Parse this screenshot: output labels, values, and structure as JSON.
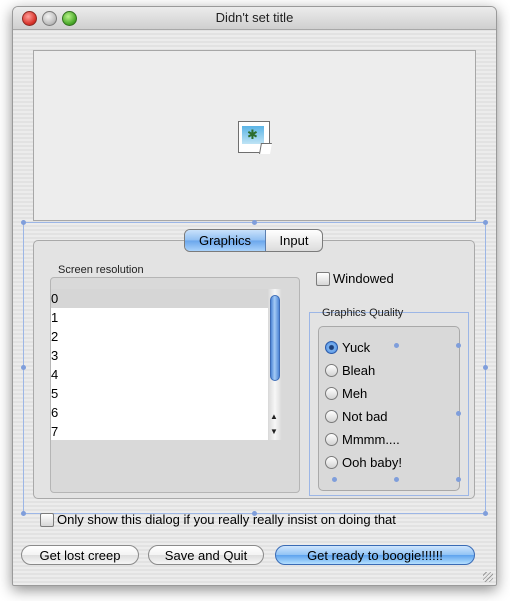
{
  "window": {
    "title": "Didn't set title"
  },
  "tabs": [
    {
      "label": "Graphics",
      "active": true
    },
    {
      "label": "Input",
      "active": false
    }
  ],
  "screen_resolution": {
    "label": "Screen resolution",
    "items": [
      "0",
      "1",
      "2",
      "3",
      "4",
      "5",
      "6",
      "7"
    ],
    "selected_index": 0
  },
  "windowed": {
    "label": "Windowed",
    "checked": false
  },
  "graphics_quality": {
    "label": "Graphics Quality",
    "options": [
      "Yuck",
      "Bleah",
      "Meh",
      "Not bad",
      "Mmmm....",
      "Ooh baby!"
    ],
    "selected_index": 0
  },
  "only_show_dialog": {
    "label": "Only show this dialog if you really really insist on doing that",
    "checked": false
  },
  "buttons": {
    "get_lost": "Get lost creep",
    "save_quit": "Save and Quit",
    "boogie": "Get ready to boogie!!!!!!"
  },
  "icons": {
    "preview": "broken-image-icon"
  }
}
